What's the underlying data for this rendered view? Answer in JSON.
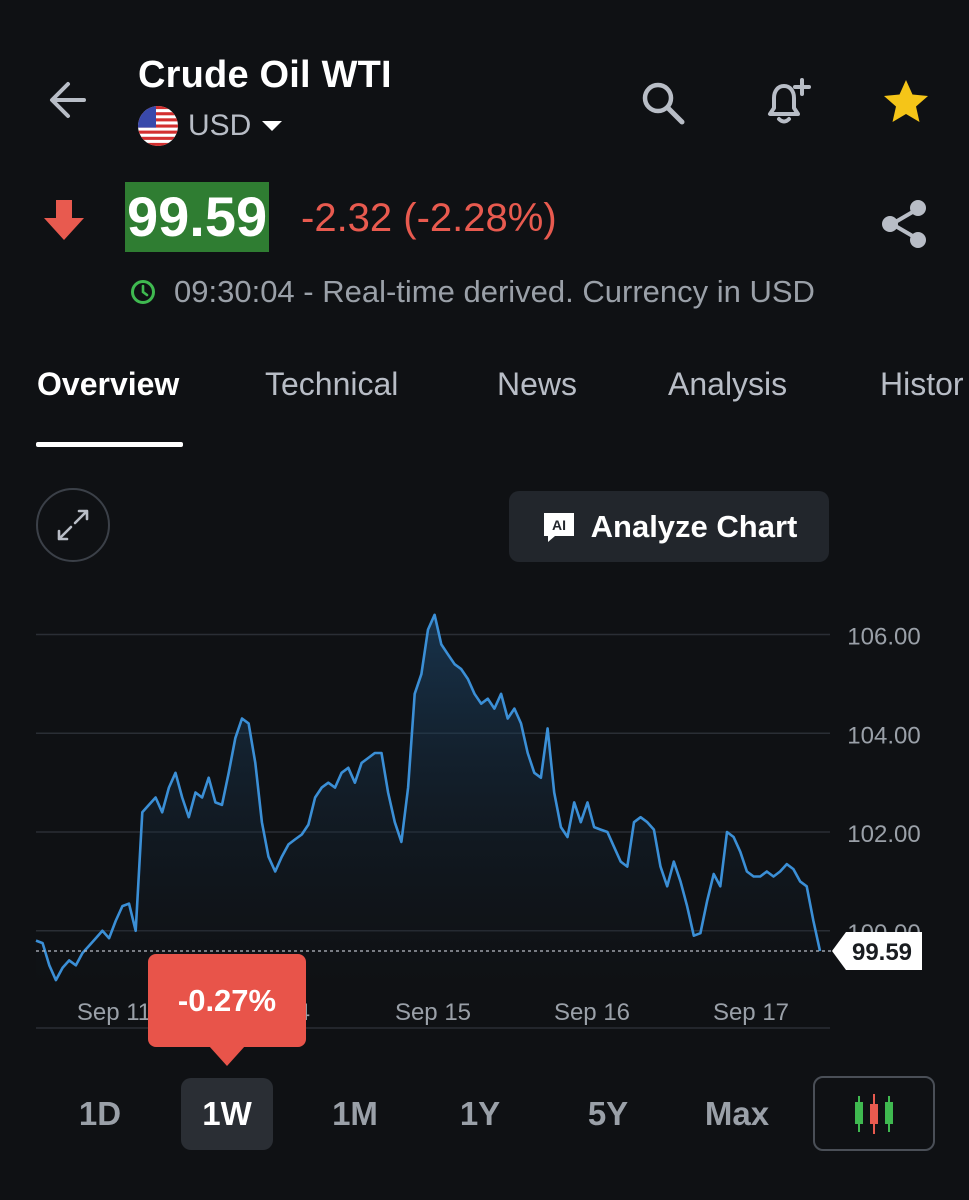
{
  "header": {
    "title": "Crude Oil WTI",
    "currency": "USD"
  },
  "quote": {
    "price": "99.59",
    "change": "-2.32 (-2.28%)",
    "status": "09:30:04 - Real-time derived. Currency in USD",
    "direction": "down"
  },
  "tabs": [
    {
      "label": "Overview",
      "active": true
    },
    {
      "label": "Technical",
      "active": false
    },
    {
      "label": "News",
      "active": false
    },
    {
      "label": "Analysis",
      "active": false
    },
    {
      "label": "Histor",
      "active": false
    }
  ],
  "chart_toolbar": {
    "analyze_label": "Analyze Chart",
    "ai_badge": "AI"
  },
  "tooltip": {
    "label": "-0.27%"
  },
  "ranges": [
    {
      "label": "1D",
      "active": false
    },
    {
      "label": "1W",
      "active": true
    },
    {
      "label": "1M",
      "active": false
    },
    {
      "label": "1Y",
      "active": false
    },
    {
      "label": "5Y",
      "active": false
    },
    {
      "label": "Max",
      "active": false
    }
  ],
  "colors": {
    "background": "#0f1114",
    "price_highlight": "#2f7d32",
    "negative": "#e85a4f",
    "line": "#3b8fd6",
    "star": "#f5c518",
    "live_dot": "#3fb950"
  },
  "icons": {
    "back": "arrow-left-icon",
    "search": "search-icon",
    "alert": "bell-plus-icon",
    "favorite": "star-icon",
    "share": "share-icon",
    "expand": "expand-icon",
    "chart_type": "candlestick-icon"
  },
  "chart_data": {
    "type": "area",
    "y_ticks": [
      "106.00",
      "104.00",
      "102.00",
      "100.00"
    ],
    "y_tick_values": [
      106,
      104,
      102,
      100
    ],
    "ylim": [
      98.8,
      106.7
    ],
    "x_labels": [
      "Sep 11",
      "Sep 14",
      "Sep 15",
      "Sep 16",
      "Sep 17"
    ],
    "current_value": 99.59,
    "current_label": "99.59",
    "grid": true,
    "series": [
      {
        "values": [
          99.8,
          99.75,
          99.3,
          99.0,
          99.25,
          99.4,
          99.3,
          99.55,
          99.7,
          99.85,
          100.0,
          99.85,
          100.2,
          100.5,
          100.55,
          100.0,
          102.4,
          102.55,
          102.7,
          102.4,
          102.9,
          103.2,
          102.7,
          102.3,
          102.8,
          102.7,
          103.1,
          102.6,
          102.55,
          103.2,
          103.9,
          104.3,
          104.2,
          103.4,
          102.2,
          101.5,
          101.2,
          101.5,
          101.75,
          101.85,
          101.95,
          102.15,
          102.7,
          102.9,
          103.0,
          102.9,
          103.2,
          103.3,
          103.0,
          103.4,
          103.5,
          103.6,
          103.6,
          102.8,
          102.2,
          101.8,
          102.9,
          104.8,
          105.2,
          106.1,
          106.4,
          105.8,
          105.6,
          105.4,
          105.3,
          105.1,
          104.8,
          104.6,
          104.7,
          104.5,
          104.8,
          104.3,
          104.5,
          104.2,
          103.6,
          103.2,
          103.1,
          104.1,
          102.8,
          102.1,
          101.9,
          102.6,
          102.2,
          102.6,
          102.1,
          102.05,
          102.0,
          101.7,
          101.4,
          101.3,
          102.2,
          102.3,
          102.2,
          102.05,
          101.3,
          100.9,
          101.4,
          101.0,
          100.5,
          99.9,
          99.95,
          100.6,
          101.15,
          100.9,
          102.0,
          101.9,
          101.6,
          101.2,
          101.1,
          101.1,
          101.2,
          101.1,
          101.2,
          101.35,
          101.25,
          101.0,
          100.9,
          100.2,
          99.59
        ]
      }
    ]
  }
}
